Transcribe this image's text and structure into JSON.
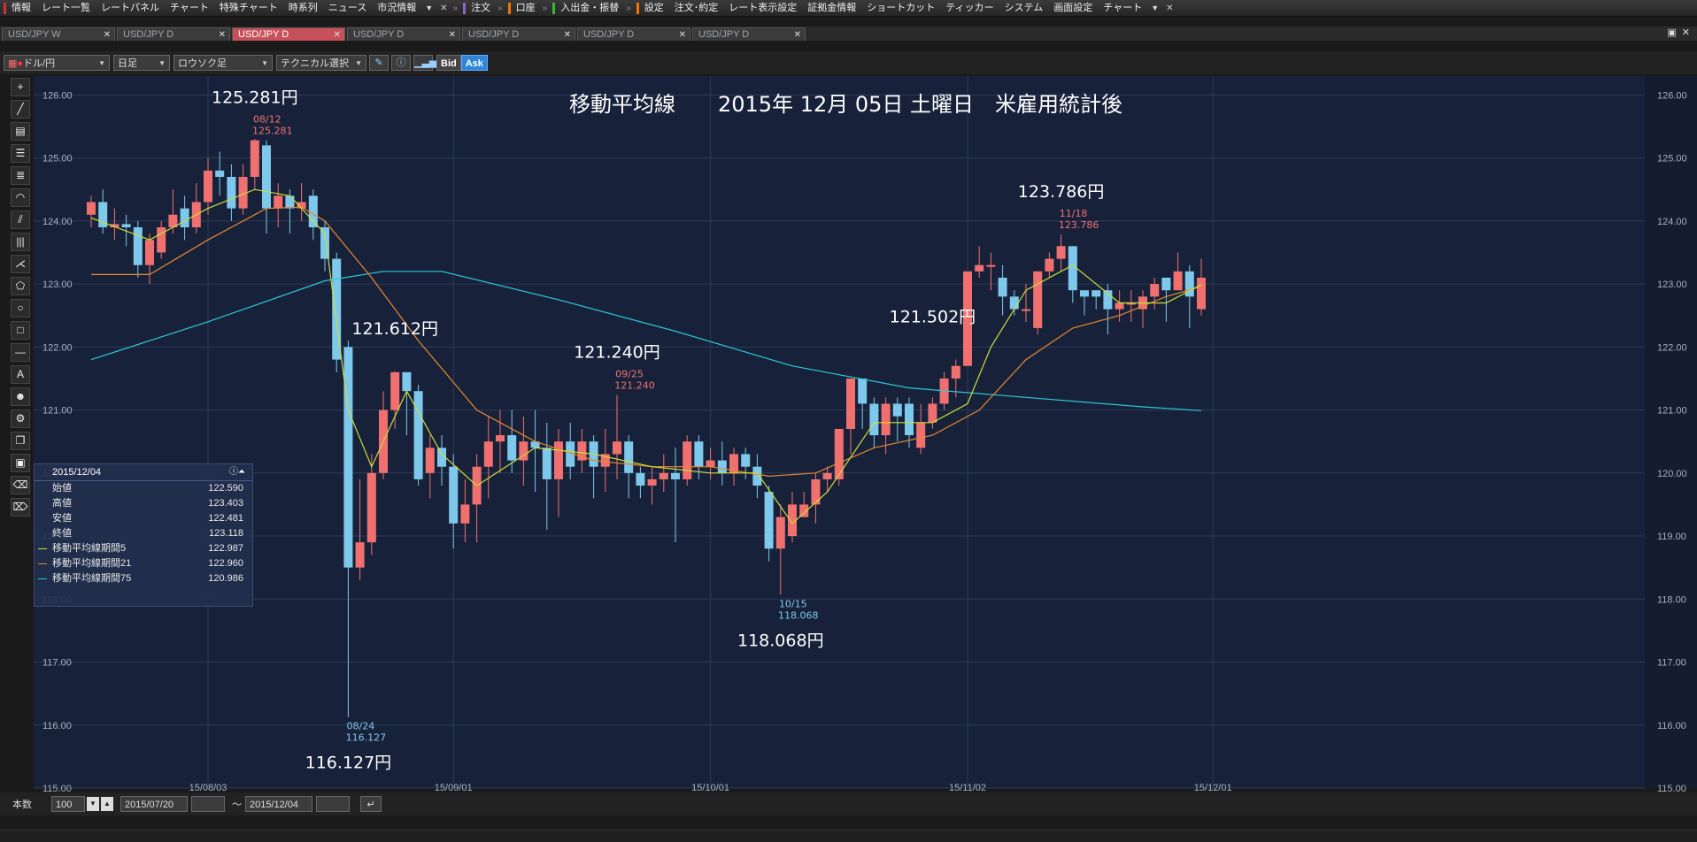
{
  "menubar": {
    "items": [
      {
        "label": "情報",
        "bar": "#c33"
      },
      {
        "label": "レート一覧"
      },
      {
        "label": "レートパネル"
      },
      {
        "label": "チャート"
      },
      {
        "label": "特殊チャート"
      },
      {
        "label": "時系列"
      },
      {
        "label": "ニュース"
      },
      {
        "label": "市況情報"
      }
    ],
    "items2": [
      {
        "label": "注文",
        "bar": "#86c"
      },
      {
        "label": "口座",
        "bar": "#e70"
      },
      {
        "label": "入出金・振替",
        "bar": "#3b3"
      },
      {
        "label": "設定",
        "bar": "#e70"
      },
      {
        "label": "注文･約定"
      },
      {
        "label": "レート表示設定"
      },
      {
        "label": "証拠金情報"
      },
      {
        "label": "ショートカット"
      },
      {
        "label": "ティッカー"
      },
      {
        "label": "システム"
      },
      {
        "label": "画面設定"
      },
      {
        "label": "チャート"
      }
    ]
  },
  "tabs": [
    {
      "label": "USD/JPY W"
    },
    {
      "label": "USD/JPY D"
    },
    {
      "label": "USD/JPY D",
      "active": true
    },
    {
      "label": "USD/JPY D"
    },
    {
      "label": "USD/JPY D"
    },
    {
      "label": "USD/JPY D"
    },
    {
      "label": "USD/JPY D"
    }
  ],
  "toolbar": {
    "pair": "ドル/円",
    "period": "日足",
    "chart_style": "ロウソク足",
    "technical": "テクニカル選択",
    "bid": "Bid",
    "ask": "Ask"
  },
  "info": {
    "date": "2015/12/04",
    "rows": [
      {
        "label": "始値",
        "value": "122.590"
      },
      {
        "label": "高値",
        "value": "123.403"
      },
      {
        "label": "安値",
        "value": "122.481"
      },
      {
        "label": "終値",
        "value": "123.118"
      },
      {
        "label": "移動平均線期間5",
        "value": "122.987",
        "color": "#cddc39"
      },
      {
        "label": "移動平均線期間21",
        "value": "122.960",
        "color": "#e8872e"
      },
      {
        "label": "移動平均線期間75",
        "value": "120.986",
        "color": "#2ec7d6"
      }
    ]
  },
  "footer": {
    "count_label": "本数",
    "count": "100",
    "from": "2015/07/20",
    "tilde": "～",
    "to": "2015/12/04"
  },
  "chart_data": {
    "type": "candlestick",
    "title": "移動平均線　　2015年 12月 05日 土曜日　米雇用統計後",
    "ylim": [
      115,
      126.3
    ],
    "y_ticks": [
      "126.00",
      "125.00",
      "124.00",
      "123.00",
      "122.00",
      "121.00",
      "120.00",
      "119.00",
      "118.00",
      "117.00",
      "116.00",
      "115.00"
    ],
    "x_ticks": [
      {
        "label": "15/08/03",
        "i": 10
      },
      {
        "label": "15/09/01",
        "i": 31
      },
      {
        "label": "15/10/01",
        "i": 53
      },
      {
        "label": "15/11/02",
        "i": 75
      },
      {
        "label": "15/12/01",
        "i": 96
      }
    ],
    "colors": {
      "up": "#f07070",
      "down": "#7ec8ec",
      "ma5": "#cddc39",
      "ma21": "#e8872e",
      "ma75": "#2ec7d6",
      "bg": "#17223a",
      "grid": "#2c3a58"
    },
    "candles": [
      [
        124.1,
        124.3,
        124.4,
        123.9
      ],
      [
        124.3,
        123.9,
        124.5,
        123.8
      ],
      [
        123.9,
        123.95,
        124.2,
        123.7
      ],
      [
        123.95,
        123.9,
        124.1,
        123.6
      ],
      [
        123.9,
        123.3,
        124.0,
        123.1
      ],
      [
        123.3,
        123.7,
        123.8,
        123.0
      ],
      [
        123.5,
        123.9,
        124.0,
        123.4
      ],
      [
        123.9,
        124.1,
        124.5,
        123.8
      ],
      [
        124.2,
        123.9,
        124.4,
        123.7
      ],
      [
        123.9,
        124.3,
        124.6,
        123.8
      ],
      [
        124.3,
        124.8,
        125.0,
        124.1
      ],
      [
        124.8,
        124.7,
        125.1,
        124.4
      ],
      [
        124.7,
        124.2,
        124.9,
        124.0
      ],
      [
        124.2,
        124.7,
        124.9,
        124.1
      ],
      [
        124.7,
        125.281,
        125.3,
        124.5
      ],
      [
        125.2,
        124.2,
        125.281,
        123.8
      ],
      [
        124.2,
        124.4,
        124.6,
        123.9
      ],
      [
        124.4,
        124.2,
        124.5,
        123.8
      ],
      [
        124.2,
        124.3,
        124.6,
        124.0
      ],
      [
        124.4,
        123.9,
        124.5,
        123.7
      ],
      [
        123.9,
        123.4,
        124.0,
        123.2
      ],
      [
        123.4,
        121.8,
        123.5,
        121.6
      ],
      [
        122.0,
        118.5,
        122.1,
        116.127
      ],
      [
        118.5,
        118.9,
        119.9,
        118.3
      ],
      [
        118.9,
        120.0,
        120.3,
        118.7
      ],
      [
        120.0,
        121.0,
        121.3,
        119.9
      ],
      [
        121.0,
        121.6,
        121.612,
        120.7
      ],
      [
        121.6,
        121.3,
        121.6,
        120.6
      ],
      [
        121.3,
        119.9,
        121.4,
        119.8
      ],
      [
        120.0,
        120.4,
        120.6,
        119.6
      ],
      [
        120.4,
        120.1,
        120.6,
        119.8
      ],
      [
        120.1,
        119.2,
        120.3,
        118.8
      ],
      [
        119.2,
        119.5,
        119.9,
        118.9
      ],
      [
        119.5,
        120.1,
        120.3,
        118.9
      ],
      [
        120.1,
        120.5,
        120.9,
        119.6
      ],
      [
        120.5,
        120.6,
        121.0,
        120.0
      ],
      [
        120.6,
        120.2,
        121.0,
        120.0
      ],
      [
        120.2,
        120.5,
        120.9,
        119.8
      ],
      [
        120.5,
        120.4,
        121.0,
        119.7
      ],
      [
        120.4,
        119.9,
        120.8,
        119.1
      ],
      [
        119.9,
        120.5,
        120.7,
        119.3
      ],
      [
        120.5,
        120.1,
        120.8,
        119.9
      ],
      [
        120.2,
        120.5,
        120.7,
        120.0
      ],
      [
        120.5,
        120.1,
        120.6,
        119.6
      ],
      [
        120.1,
        120.3,
        120.7,
        119.7
      ],
      [
        120.3,
        120.5,
        121.24,
        119.9
      ],
      [
        120.5,
        120.0,
        120.6,
        119.6
      ],
      [
        120.0,
        119.8,
        120.1,
        119.6
      ],
      [
        119.8,
        119.9,
        120.1,
        119.5
      ],
      [
        119.9,
        120.0,
        120.3,
        119.7
      ],
      [
        120.0,
        119.9,
        120.4,
        118.9
      ],
      [
        119.9,
        120.5,
        120.6,
        119.8
      ],
      [
        120.5,
        120.1,
        120.6,
        119.9
      ],
      [
        120.1,
        120.2,
        120.4,
        119.9
      ],
      [
        120.2,
        120.0,
        120.5,
        119.8
      ],
      [
        120.0,
        120.3,
        120.4,
        119.8
      ],
      [
        120.3,
        120.1,
        120.4,
        119.9
      ],
      [
        120.1,
        119.8,
        120.3,
        119.6
      ],
      [
        119.7,
        118.8,
        119.8,
        118.6
      ],
      [
        118.8,
        119.3,
        119.5,
        118.068
      ],
      [
        119.0,
        119.5,
        119.7,
        118.9
      ],
      [
        119.3,
        119.5,
        119.7,
        119.3
      ],
      [
        119.5,
        119.9,
        120.0,
        119.2
      ],
      [
        119.9,
        120.0,
        120.1,
        119.7
      ],
      [
        119.9,
        120.7,
        120.7,
        119.8
      ],
      [
        120.7,
        121.5,
        121.5,
        120.3
      ],
      [
        121.5,
        121.1,
        121.5,
        120.7
      ],
      [
        121.1,
        120.6,
        121.2,
        120.4
      ],
      [
        120.6,
        121.1,
        121.2,
        120.3
      ],
      [
        121.1,
        120.9,
        121.2,
        120.5
      ],
      [
        121.1,
        120.6,
        121.2,
        120.4
      ],
      [
        120.4,
        120.8,
        121.1,
        120.3
      ],
      [
        120.8,
        121.1,
        121.2,
        120.7
      ],
      [
        121.1,
        121.5,
        121.6,
        121.0
      ],
      [
        121.5,
        121.7,
        121.8,
        121.2
      ],
      [
        121.7,
        123.2,
        123.2,
        121.7
      ],
      [
        123.2,
        123.3,
        123.6,
        123.1
      ],
      [
        123.3,
        123.3,
        123.5,
        122.9
      ],
      [
        123.1,
        122.8,
        123.3,
        122.5
      ],
      [
        122.8,
        122.6,
        122.9,
        122.5
      ],
      [
        122.6,
        122.6,
        123.0,
        122.4
      ],
      [
        122.3,
        123.2,
        123.2,
        122.2
      ],
      [
        123.2,
        123.4,
        123.5,
        123.1
      ],
      [
        123.4,
        123.6,
        123.786,
        123.2
      ],
      [
        123.6,
        122.9,
        123.6,
        122.7
      ],
      [
        122.9,
        122.8,
        122.9,
        122.5
      ],
      [
        122.9,
        122.8,
        122.9,
        122.6
      ],
      [
        122.9,
        122.6,
        123.0,
        122.2
      ],
      [
        122.6,
        122.7,
        122.9,
        122.4
      ],
      [
        122.7,
        122.7,
        122.9,
        122.4
      ],
      [
        122.6,
        122.8,
        122.9,
        122.3
      ],
      [
        122.8,
        123.0,
        123.1,
        122.6
      ],
      [
        123.1,
        122.9,
        123.1,
        122.4
      ],
      [
        122.9,
        123.2,
        123.5,
        122.9
      ],
      [
        123.2,
        122.8,
        123.3,
        122.3
      ],
      [
        122.6,
        123.1,
        123.4,
        122.5
      ]
    ],
    "ma5_x": [
      0,
      5,
      10,
      14,
      17,
      20,
      22,
      24,
      27,
      30,
      33,
      38,
      43,
      48,
      53,
      57,
      60,
      63,
      67,
      72,
      75,
      77,
      80,
      84,
      88,
      92,
      95
    ],
    "ma5_y": [
      124.05,
      123.7,
      124.2,
      124.5,
      124.4,
      123.8,
      121.0,
      120.1,
      121.3,
      120.3,
      119.8,
      120.4,
      120.3,
      120.1,
      120.0,
      120.0,
      119.2,
      119.7,
      120.8,
      120.8,
      121.1,
      122.0,
      122.9,
      123.3,
      122.7,
      122.7,
      122.99
    ],
    "ma21_x": [
      0,
      5,
      10,
      15,
      18,
      20,
      24,
      28,
      33,
      38,
      43,
      48,
      53,
      58,
      62,
      67,
      72,
      76,
      80,
      84,
      88,
      92,
      95
    ],
    "ma21_y": [
      123.15,
      123.15,
      123.7,
      124.2,
      124.22,
      124.0,
      123.1,
      122.1,
      121.0,
      120.5,
      120.2,
      120.1,
      120.1,
      119.95,
      120.0,
      120.4,
      120.6,
      121.0,
      121.8,
      122.3,
      122.5,
      122.8,
      122.96
    ],
    "ma75_x": [
      0,
      10,
      20,
      25,
      30,
      40,
      50,
      60,
      70,
      80,
      90,
      95
    ],
    "ma75_y": [
      121.8,
      122.4,
      123.05,
      123.2,
      123.2,
      122.75,
      122.25,
      121.7,
      121.35,
      121.2,
      121.05,
      120.99
    ],
    "annotations": [
      {
        "text": "125.281円",
        "i": 14,
        "y": 125.281,
        "pos": "above",
        "big": true
      },
      {
        "text": "08/12",
        "i": 14,
        "y": 125.281,
        "pos": "small1",
        "color": "#f07070"
      },
      {
        "text": "125.281",
        "i": 14,
        "y": 125.281,
        "pos": "small2",
        "color": "#f07070"
      },
      {
        "text": "116.127円",
        "i": 22,
        "y": 116.127,
        "pos": "below",
        "big": true
      },
      {
        "text": "08/24",
        "i": 22,
        "y": 116.127,
        "pos": "bsmall1",
        "color": "#7ec8ec"
      },
      {
        "text": "116.127",
        "i": 22,
        "y": 116.127,
        "pos": "bsmall2",
        "color": "#7ec8ec"
      },
      {
        "text": "121.612円",
        "i": 26,
        "y": 121.612,
        "pos": "above",
        "big": true
      },
      {
        "text": "121.240円",
        "i": 45,
        "y": 121.24,
        "pos": "above",
        "big": true
      },
      {
        "text": "09/25",
        "i": 45,
        "y": 121.24,
        "pos": "small1",
        "color": "#f07070"
      },
      {
        "text": "121.240",
        "i": 45,
        "y": 121.24,
        "pos": "small2",
        "color": "#f07070"
      },
      {
        "text": "118.068円",
        "i": 59,
        "y": 118.068,
        "pos": "below",
        "big": true
      },
      {
        "text": "10/15",
        "i": 59,
        "y": 118.068,
        "pos": "bsmall1",
        "color": "#7ec8ec"
      },
      {
        "text": "118.068",
        "i": 59,
        "y": 118.068,
        "pos": "bsmall2",
        "color": "#7ec8ec"
      },
      {
        "text": "121.502円",
        "i": 72,
        "y": 121.8,
        "pos": "above",
        "big": true
      },
      {
        "text": "123.786円",
        "i": 83,
        "y": 123.786,
        "pos": "above",
        "big": true
      },
      {
        "text": "11/18",
        "i": 83,
        "y": 123.786,
        "pos": "small1",
        "color": "#f07070"
      },
      {
        "text": "123.786",
        "i": 83,
        "y": 123.786,
        "pos": "small2",
        "color": "#f07070"
      }
    ]
  }
}
